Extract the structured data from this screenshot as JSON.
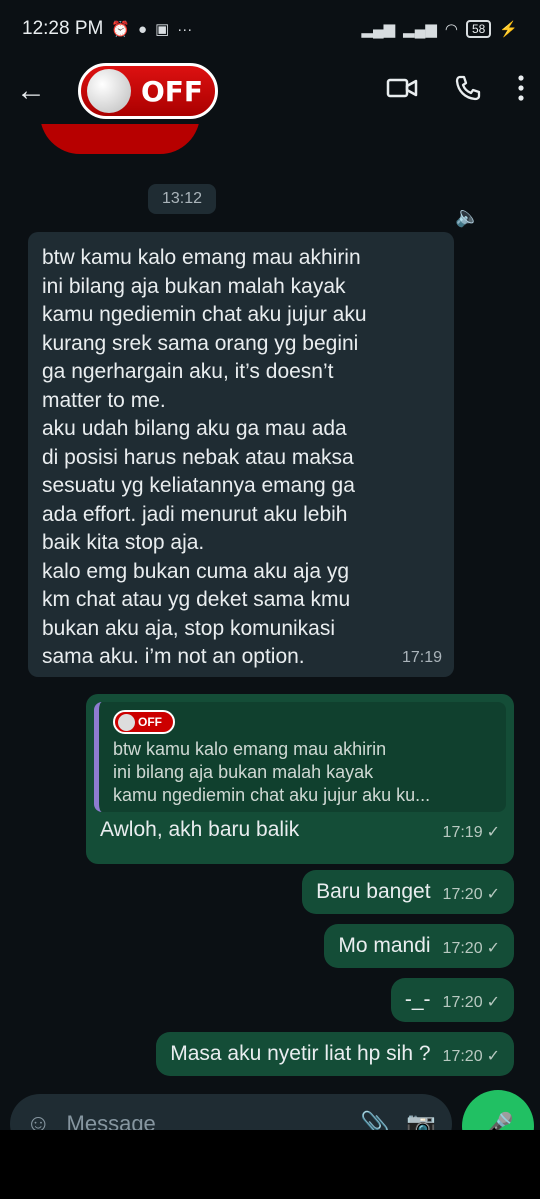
{
  "status_bar": {
    "time": "12:28 PM",
    "battery": "58"
  },
  "header": {
    "avatar_text": "OFF"
  },
  "chat": {
    "date_chip": "13:12",
    "incoming": {
      "text": "btw kamu kalo emang mau akhirin\nini bilang aja bukan malah kayak\nkamu ngediemin chat aku jujur aku\nkurang srek sama orang yg begini\nga ngerhargain aku, it’s doesn’t\nmatter to me.\naku udah bilang aku ga mau ada\ndi posisi harus nebak atau maksa\nsesuatu yg keliatannya emang ga\nada effort. jadi menurut aku lebih\nbaik kita stop aja.\nkalo emg bukan cuma aku aja yg\nkm chat atau yg deket sama kmu\nbukan aku aja, stop komunikasi\nsama aku. i’m not an option.",
      "time": "17:19"
    },
    "reply": {
      "quote_sender": "OFF",
      "quote_text": "btw kamu kalo emang mau akhirin\nini bilang aja bukan malah kayak\nkamu ngediemin chat aku jujur aku ku...",
      "text": "Awloh, akh baru balik",
      "time": "17:19"
    },
    "outgoing": [
      {
        "text": "Baru banget",
        "time": "17:20"
      },
      {
        "text": "Mo mandi",
        "time": "17:20"
      },
      {
        "text": "-_-",
        "time": "17:20"
      },
      {
        "text": "Masa aku nyetir liat hp sih ?",
        "time": "17:20"
      }
    ]
  },
  "composer": {
    "placeholder": "Message"
  },
  "colors": {
    "incoming_bubble": "#1f2c33",
    "outgoing_bubble": "#144d37",
    "mic_button": "#21c063",
    "quote_bar": "#8e7cd1"
  },
  "icons": {
    "back": "arrow-left-icon",
    "video": "video-camera-icon",
    "call": "phone-icon",
    "menu": "more-vert-icon",
    "emoji": "emoji-icon",
    "attach": "paperclip-icon",
    "camera": "camera-icon",
    "mic": "mic-icon",
    "read": "double-check-icon"
  }
}
